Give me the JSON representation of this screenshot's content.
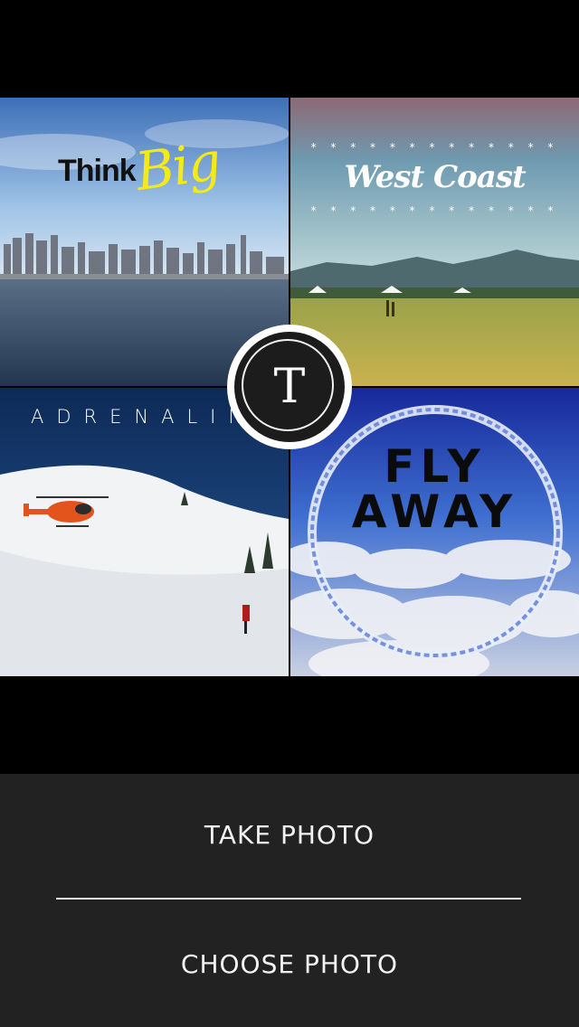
{
  "collage": {
    "tile1": {
      "word1": "Think",
      "word2": "Big"
    },
    "tile2": {
      "title": "West Coast",
      "stars_top": "* * * * * * * * * * * * *",
      "stars_bottom": "* * * * * * * * * * * * *"
    },
    "tile3": {
      "title": "ADRENALIN"
    },
    "tile4": {
      "line1": "FLY",
      "line2": "AWAY"
    }
  },
  "logo": {
    "letter": "T",
    "icon": "typography-logo-icon"
  },
  "actions": {
    "take_photo": "TAKE PHOTO",
    "choose_photo": "CHOOSE PHOTO"
  },
  "colors": {
    "background": "#000000",
    "panel": "#222222",
    "accent_yellow": "#f4ea16",
    "text": "#f2f2f2"
  }
}
